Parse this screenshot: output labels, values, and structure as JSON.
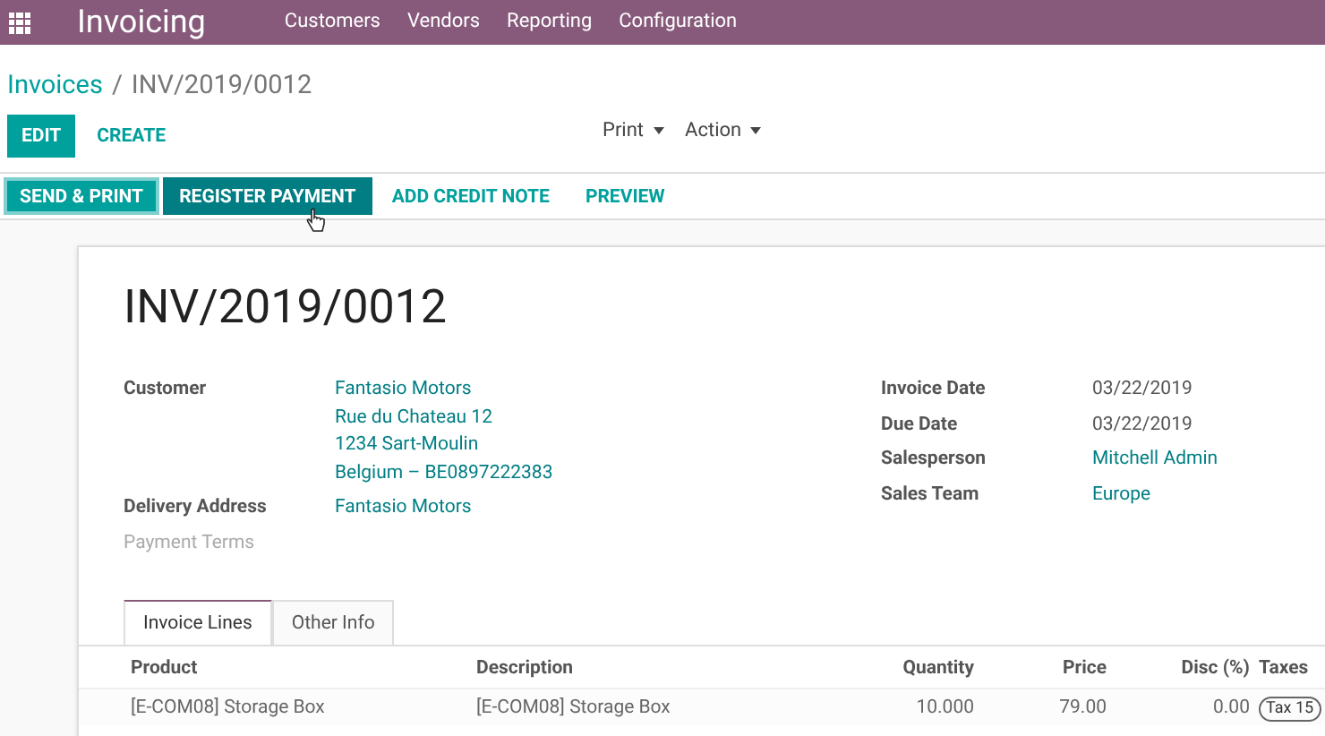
{
  "app_title": "Invoicing",
  "menu": [
    "Customers",
    "Vendors",
    "Reporting",
    "Configuration"
  ],
  "breadcrumb": {
    "parent": "Invoices",
    "separator": "/",
    "current": "INV/2019/0012"
  },
  "toolbar": {
    "primary": "EDIT",
    "secondary": "CREATE",
    "dropdowns": [
      "Print",
      "Action"
    ]
  },
  "actions": [
    {
      "label": "SEND & PRINT",
      "kind": "primary"
    },
    {
      "label": "REGISTER PAYMENT",
      "kind": "dark"
    },
    {
      "label": "ADD CREDIT NOTE",
      "kind": "link"
    },
    {
      "label": "PREVIEW",
      "kind": "link"
    }
  ],
  "invoice_number": "INV/2019/0012",
  "left_fields": [
    {
      "label": "Customer",
      "muted": false,
      "kind": "link",
      "lines": [
        "Fantasio Motors",
        "Rue du Chateau 12",
        "1234 Sart-Moulin",
        "Belgium – BE0897222383"
      ]
    },
    {
      "label": "Delivery Address",
      "muted": false,
      "kind": "link",
      "lines": [
        "Fantasio Motors"
      ]
    },
    {
      "label": "Payment Terms",
      "muted": true
    }
  ],
  "right_fields": [
    {
      "label": "Invoice Date",
      "kind": "text",
      "value": "03/22/2019"
    },
    {
      "label": "Due Date",
      "kind": "text",
      "value": "03/22/2019"
    },
    {
      "label": "Salesperson",
      "kind": "link",
      "value": "Mitchell Admin"
    },
    {
      "label": "Sales Team",
      "kind": "link",
      "value": "Europe"
    }
  ],
  "tabs": [
    {
      "label": "Invoice Lines",
      "selected": true
    },
    {
      "label": "Other Info",
      "selected": false
    }
  ],
  "table": {
    "columns": [
      "Product",
      "Description",
      "Quantity",
      "Price",
      "Disc (%)",
      "Taxes"
    ],
    "rows": [
      {
        "product": "[E-COM08] Storage Box",
        "description": "[E-COM08] Storage Box",
        "quantity": "10.000",
        "price": "79.00",
        "discount": "0.00",
        "tax": "Tax 15"
      }
    ]
  }
}
